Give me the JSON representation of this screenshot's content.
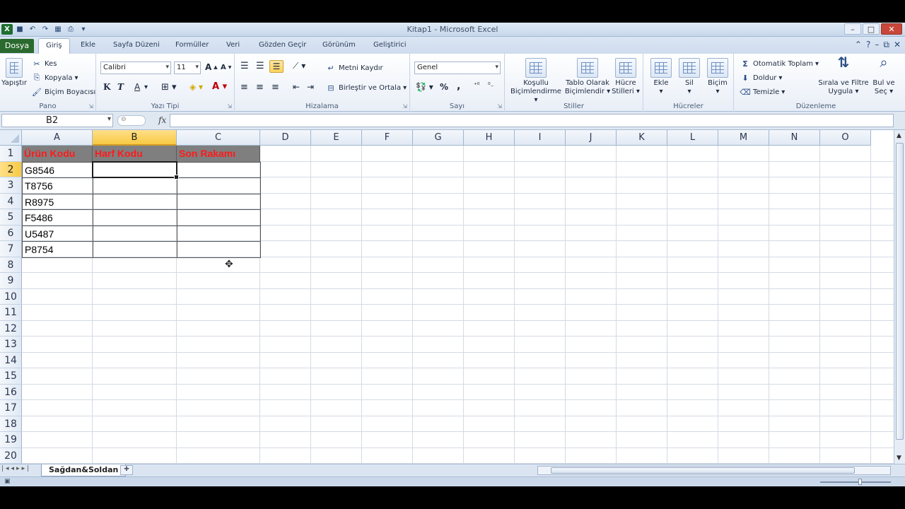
{
  "window": {
    "title": "Kitap1 - Microsoft Excel",
    "minimize": "–",
    "maximize": "□",
    "close": "✕"
  },
  "tabs": {
    "file": "Dosya",
    "items": [
      "Giriş",
      "Ekle",
      "Sayfa Düzeni",
      "Formüller",
      "Veri",
      "Gözden Geçir",
      "Görünüm",
      "Geliştirici"
    ],
    "active": "Giriş"
  },
  "ribbon": {
    "pano": {
      "label": "Pano",
      "paste": "Yapıştır",
      "cut": "Kes",
      "copy": "Kopyala",
      "format_painter": "Biçim Boyacısı"
    },
    "font": {
      "label": "Yazı Tipi",
      "name": "Calibri",
      "size": "11",
      "bold": "K",
      "italic": "T",
      "underline": "A"
    },
    "alignment": {
      "label": "Hizalama",
      "wrap_text": "Metni Kaydır",
      "merge_center": "Birleştir ve Ortala"
    },
    "number": {
      "label": "Sayı",
      "format": "Genel",
      "percent": "%",
      "comma": ","
    },
    "styles": {
      "label": "Stiller",
      "conditional": "Koşullu\nBiçimlendirme",
      "conditional_1": "Koşullu",
      "conditional_2": "Biçimlendirme",
      "table_1": "Tablo Olarak",
      "table_2": "Biçimlendir",
      "cell_1": "Hücre",
      "cell_2": "Stilleri"
    },
    "cells": {
      "label": "Hücreler",
      "insert": "Ekle",
      "delete": "Sil",
      "format": "Biçim"
    },
    "editing": {
      "label": "Düzenleme",
      "autosum": "Otomatik Toplam",
      "fill": "Doldur",
      "clear": "Temizle",
      "sort_1": "Sırala ve Filtre",
      "sort_2": "Uygula",
      "find_1": "Bul ve",
      "find_2": "Seç"
    }
  },
  "formula_bar": {
    "name_box": "B2",
    "fx": "fx",
    "value": ""
  },
  "grid": {
    "columns": [
      "A",
      "B",
      "C",
      "D",
      "E",
      "F",
      "G",
      "H",
      "I",
      "J",
      "K",
      "L",
      "M",
      "N",
      "O"
    ],
    "rows": [
      "1",
      "2",
      "3",
      "4",
      "5",
      "6",
      "7",
      "8",
      "9",
      "10",
      "11",
      "12",
      "13",
      "14",
      "15",
      "16",
      "17",
      "18",
      "19",
      "20"
    ],
    "selected_column": "B",
    "selected_row": "2",
    "header_row": [
      "Ürün Kodu",
      "Harf Kodu",
      "Son Rakamı"
    ],
    "data": [
      "G8546",
      "T8756",
      "R8975",
      "F5486",
      "U5487",
      "P8754"
    ]
  },
  "sheets": {
    "active": "Sağdan&Soldan"
  },
  "colors": {
    "header_fill": "#7f7f7f",
    "header_text": "#ff1a1a",
    "selection_header": "#f8c943",
    "file_tab": "#2b6a2e"
  }
}
